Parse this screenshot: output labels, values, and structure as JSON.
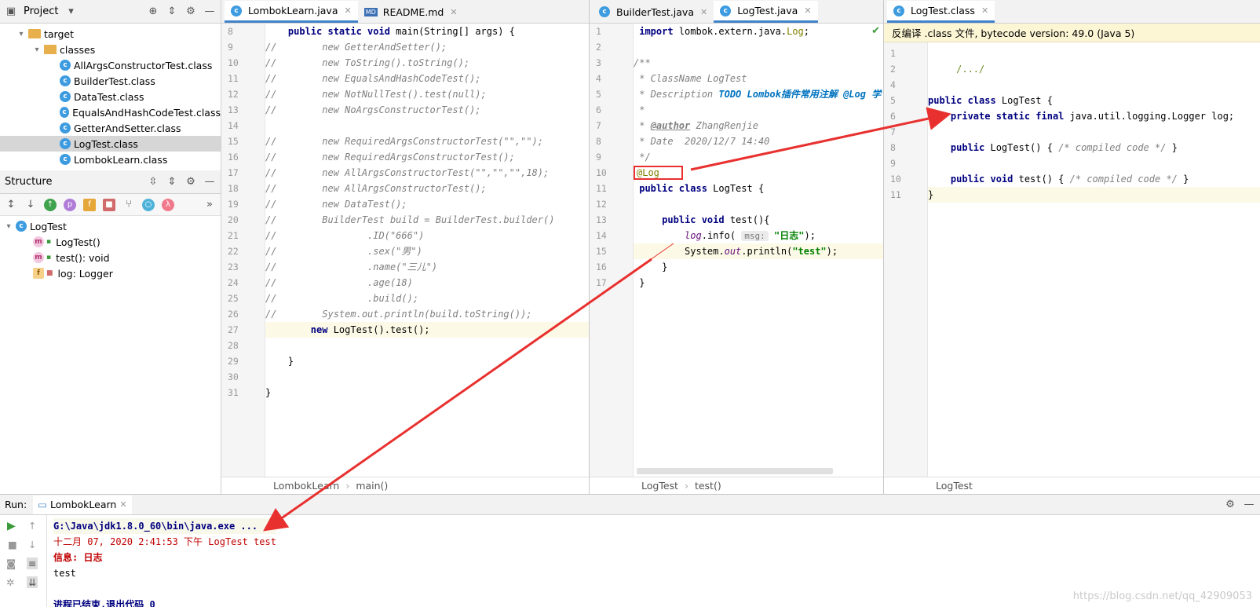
{
  "project": {
    "title": "Project",
    "items": [
      {
        "label": "target",
        "level": 1,
        "kind": "folder",
        "expanded": true
      },
      {
        "label": "classes",
        "level": 2,
        "kind": "folder",
        "expanded": true
      },
      {
        "label": "AllArgsConstructorTest.class",
        "level": 3,
        "kind": "class"
      },
      {
        "label": "BuilderTest.class",
        "level": 3,
        "kind": "class"
      },
      {
        "label": "DataTest.class",
        "level": 3,
        "kind": "class"
      },
      {
        "label": "EqualsAndHashCodeTest.class",
        "level": 3,
        "kind": "class"
      },
      {
        "label": "GetterAndSetter.class",
        "level": 3,
        "kind": "class"
      },
      {
        "label": "LogTest.class",
        "level": 3,
        "kind": "class",
        "selected": true
      },
      {
        "label": "LombokLearn.class",
        "level": 3,
        "kind": "class"
      }
    ]
  },
  "structure": {
    "title": "Structure",
    "root": "LogTest",
    "members": [
      {
        "label": "LogTest()",
        "icon": "m"
      },
      {
        "label": "test(): void",
        "icon": "m"
      },
      {
        "label": "log: Logger",
        "icon": "f"
      }
    ]
  },
  "editor1": {
    "tabs": [
      {
        "label": "LombokLearn.java",
        "active": true
      },
      {
        "label": "README.md",
        "active": false
      }
    ],
    "lines": [
      8,
      9,
      10,
      11,
      12,
      13,
      14,
      15,
      16,
      17,
      18,
      19,
      20,
      21,
      22,
      23,
      24,
      25,
      26,
      27,
      28,
      29,
      30,
      31
    ],
    "breadcrumb": [
      "LombokLearn",
      "main()"
    ]
  },
  "editor2": {
    "tabs": [
      {
        "label": "BuilderTest.java",
        "active": false
      },
      {
        "label": "LogTest.java",
        "active": true
      }
    ],
    "lines": [
      1,
      2,
      3,
      4,
      5,
      6,
      7,
      8,
      9,
      10,
      11,
      12,
      13,
      14,
      15,
      16,
      17
    ],
    "breadcrumb": [
      "LogTest",
      "test()"
    ]
  },
  "editor3": {
    "tabs": [
      {
        "label": "LogTest.class",
        "active": true
      }
    ],
    "banner": "反编译 .class 文件, bytecode version: 49.0 (Java 5)",
    "lines": [
      1,
      2,
      4,
      5,
      6,
      7,
      8,
      9,
      10,
      11
    ],
    "breadcrumb": [
      "LogTest"
    ]
  },
  "run": {
    "label": "Run:",
    "tab": "LombokLearn",
    "output": [
      "G:\\Java\\jdk1.8.0_60\\bin\\java.exe ...",
      "十二月 07, 2020 2:41:53 下午 LogTest test",
      "信息: 日志",
      "test",
      "",
      "进程已结束,退出代码 0"
    ]
  },
  "watermark": "https://blog.csdn.net/qq_42909053",
  "colors": {
    "arrow": "#e8312f",
    "accent": "#4083c9",
    "highlight": "#fcfae6"
  }
}
